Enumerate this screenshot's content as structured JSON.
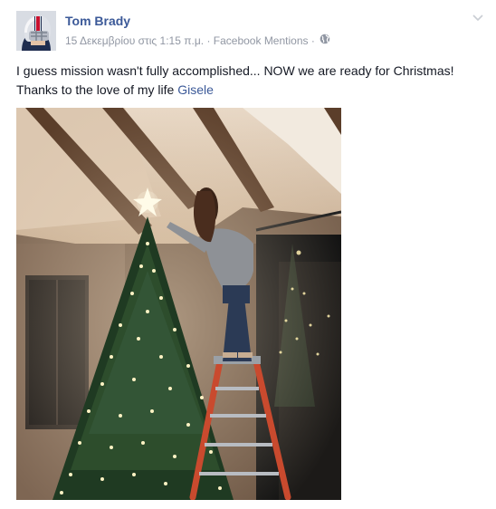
{
  "post": {
    "author": "Tom Brady",
    "date": "15 Δεκεμβρίου στις 1:15 π.μ.",
    "separator": "·",
    "app": "Facebook Mentions",
    "privacy_icon": "globe-icon",
    "menu_icon": "chevron-down-icon",
    "text_before_mention": "I guess mission wasn't fully accomplished... NOW we are ready for Christmas! Thanks to the love of my life ",
    "mention": "Gisele"
  },
  "colors": {
    "link": "#3b5998",
    "meta": "#9197a3",
    "text": "#141823"
  }
}
